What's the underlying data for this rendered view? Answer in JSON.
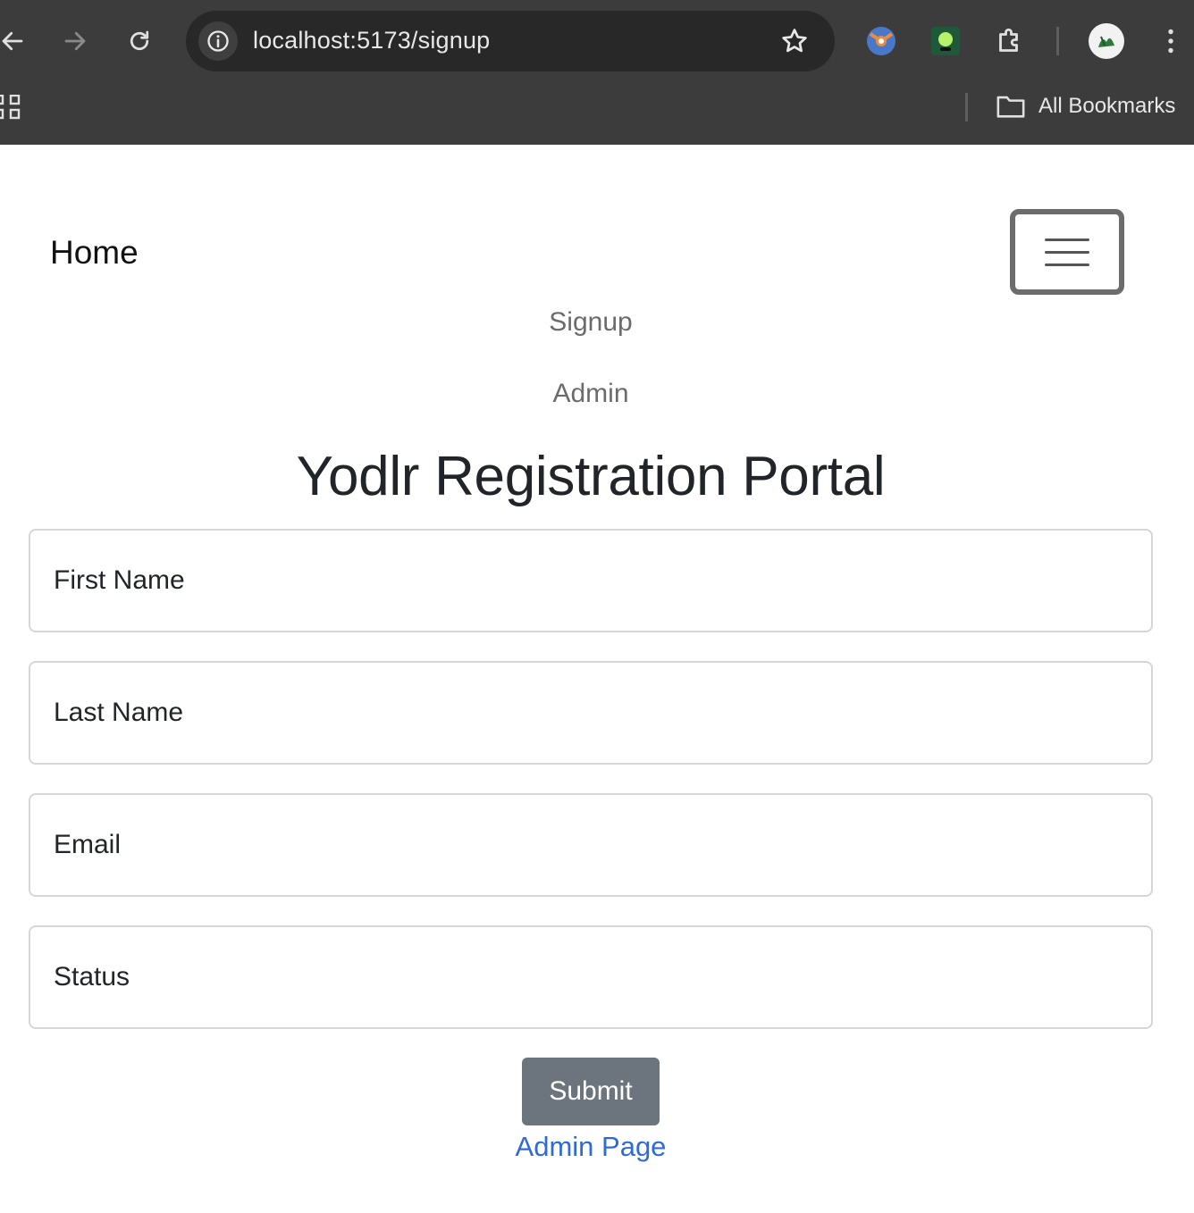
{
  "browser": {
    "url": "localhost:5173/signup",
    "bookmarks_label": "All Bookmarks",
    "accent_colors": {
      "chrome_bg": "#3c3c3c",
      "omnibox_bg": "#282828"
    }
  },
  "navbar": {
    "brand": "Home",
    "links": [
      "Signup",
      "Admin"
    ]
  },
  "form": {
    "title": "Yodlr Registration Portal",
    "fields": [
      {
        "placeholder": "First Name"
      },
      {
        "placeholder": "Last Name"
      },
      {
        "placeholder": "Email"
      },
      {
        "placeholder": "Status"
      }
    ],
    "submit_label": "Submit",
    "admin_link": "Admin Page"
  },
  "colors": {
    "submit_bg": "#6c757d",
    "link": "#2e6bd8",
    "nav_link": "#6b6b6b"
  }
}
